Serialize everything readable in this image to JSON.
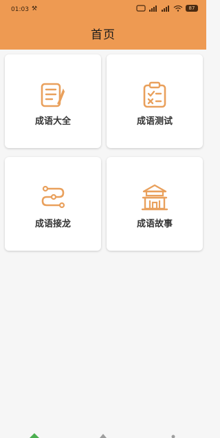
{
  "status_bar": {
    "time": "01:03",
    "tool_glyph": "⚒",
    "battery": "87"
  },
  "header": {
    "title": "首页"
  },
  "cards": [
    {
      "label": "成语大全",
      "icon": "notebook-pen-icon"
    },
    {
      "label": "成语测试",
      "icon": "clipboard-check-icon"
    },
    {
      "label": "成语接龙",
      "icon": "chain-route-icon"
    },
    {
      "label": "成语故事",
      "icon": "temple-icon"
    }
  ],
  "colors": {
    "header_bg": "#ee9a52",
    "icon": "#e9a05c",
    "nav_active": "#4caf50",
    "nav_inactive": "#9e9e9e"
  }
}
